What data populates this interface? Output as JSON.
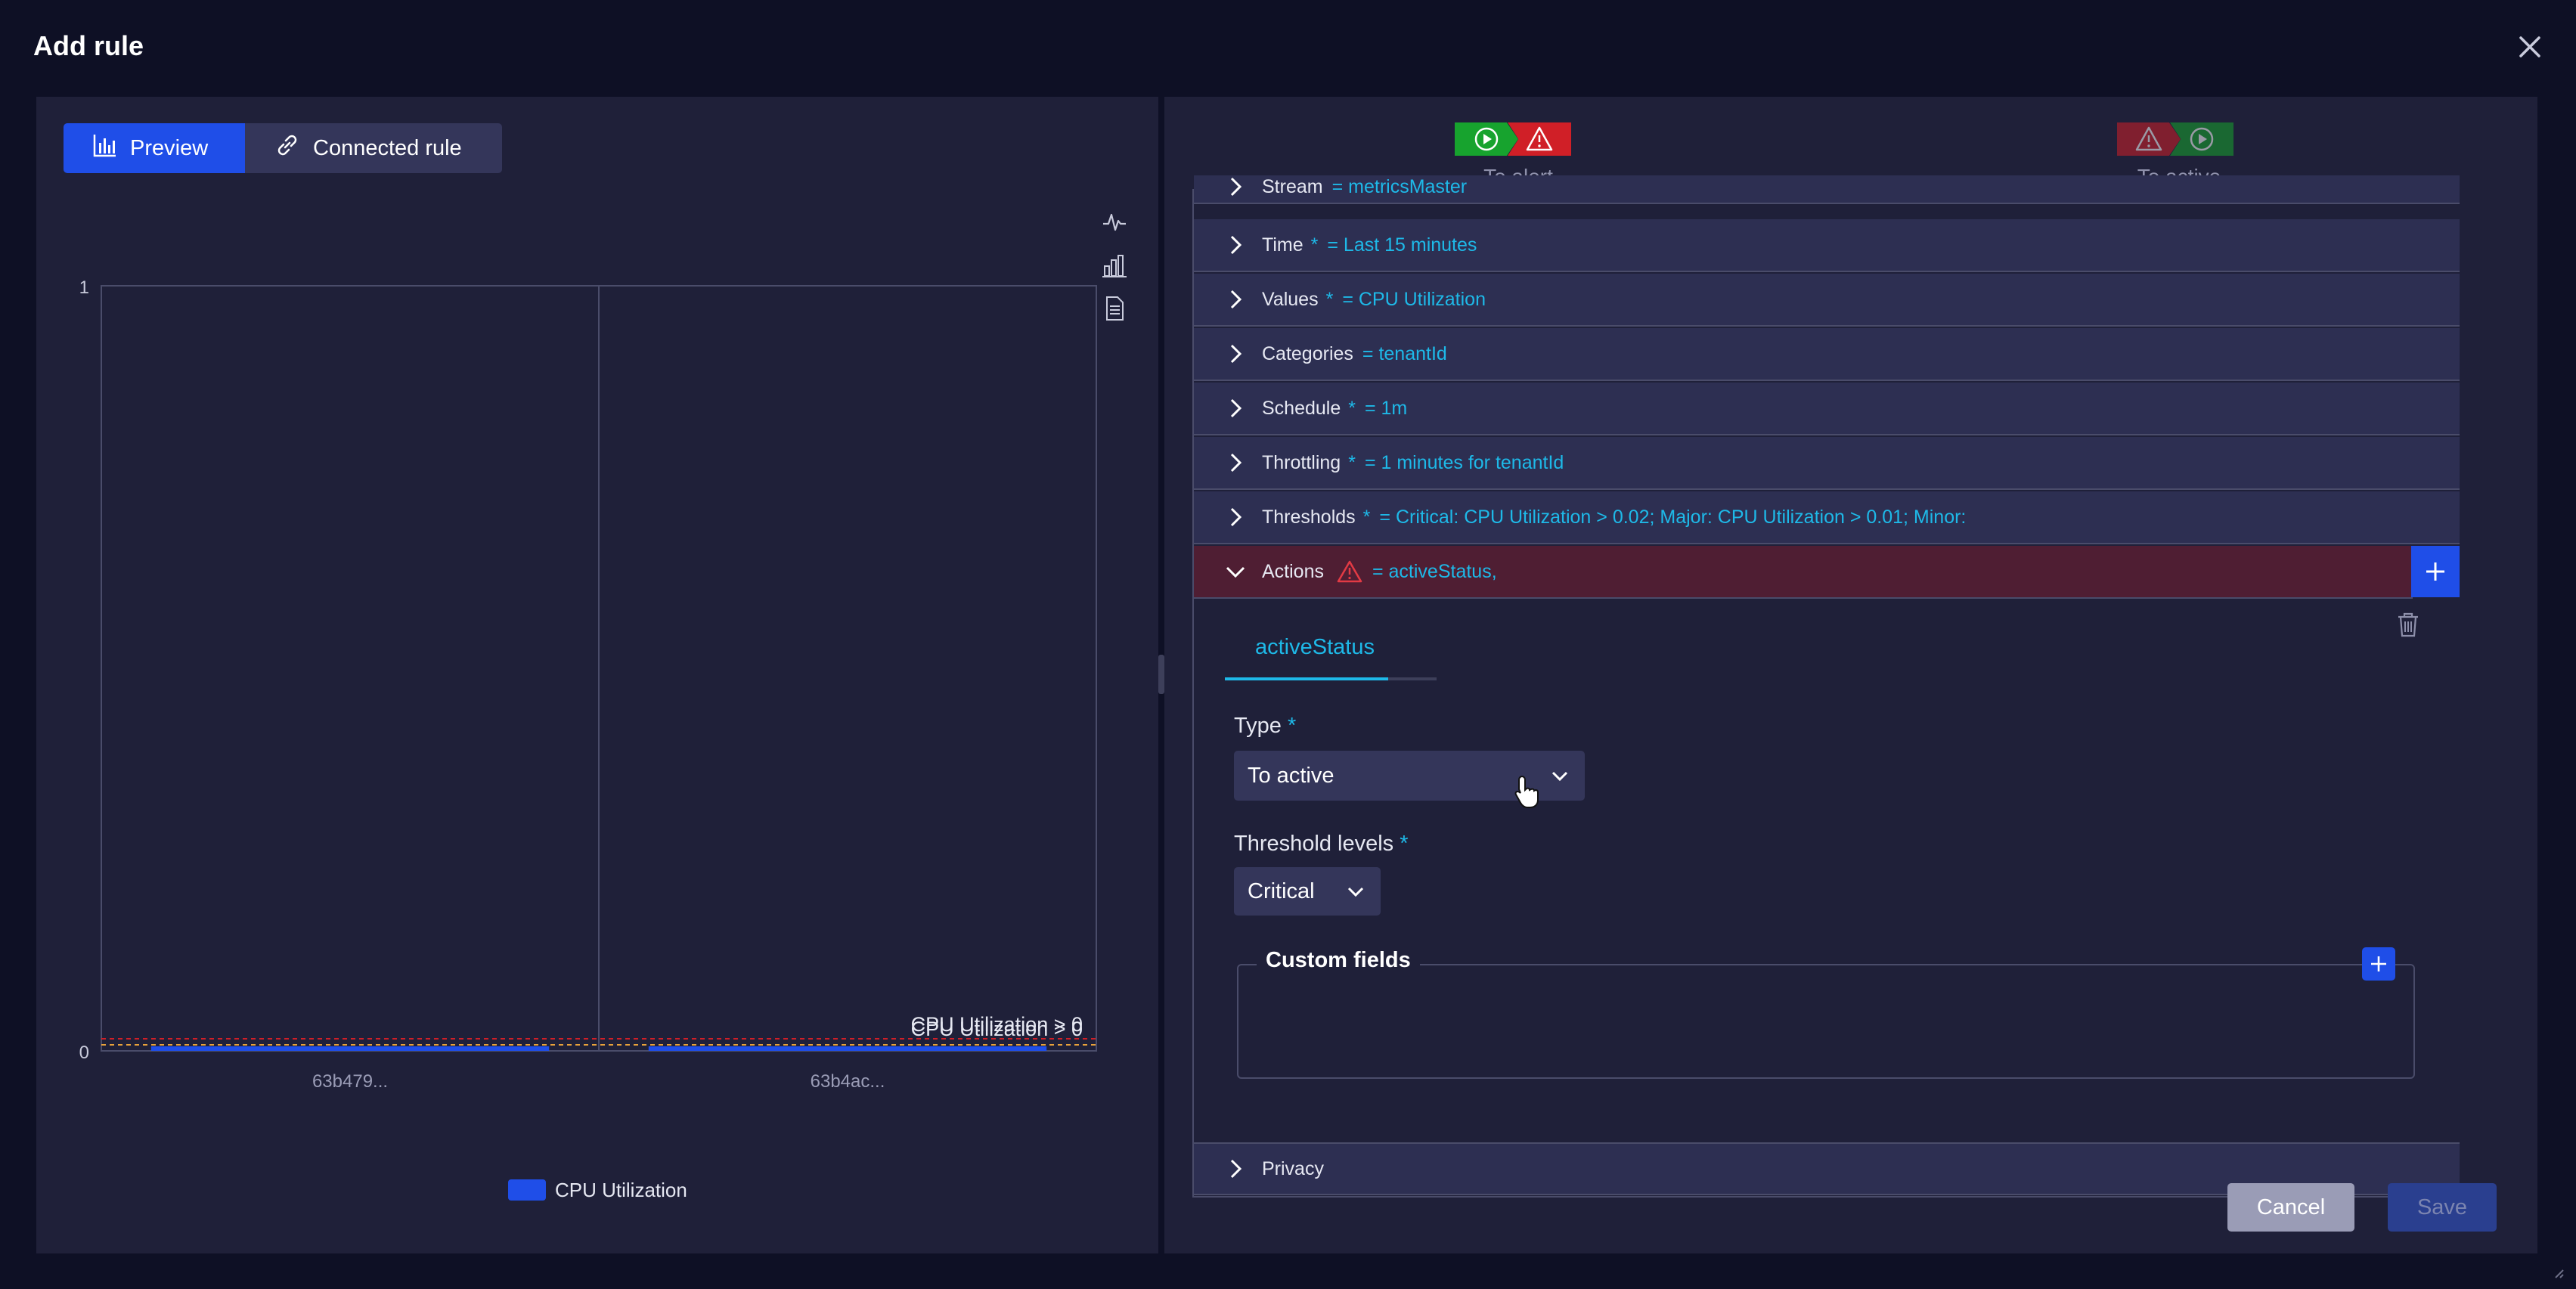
{
  "dialog": {
    "title": "Add rule"
  },
  "tabs": [
    {
      "label": "Preview"
    },
    {
      "label": "Connected rule"
    }
  ],
  "flow": {
    "to_alert_label": "To alert",
    "to_active_label": "To active"
  },
  "colors": {
    "accent": "#1f4ee8",
    "ok_green": "#17a32e",
    "alert_red": "#d01f27",
    "cyan": "#1eb9e8",
    "actions_bg": "#4f1e33"
  },
  "accordion": {
    "stream": {
      "label": "Stream",
      "required": "",
      "value": "= metricsMaster"
    },
    "time": {
      "label": "Time",
      "required": "*",
      "value": "= Last 15 minutes"
    },
    "values": {
      "label": "Values",
      "required": "*",
      "value": "= CPU Utilization"
    },
    "categories": {
      "label": "Categories",
      "required": "",
      "value": "= tenantId"
    },
    "schedule": {
      "label": "Schedule",
      "required": "*",
      "value": "= 1m"
    },
    "throttling": {
      "label": "Throttling",
      "required": "*",
      "value": "= 1 minutes for tenantId"
    },
    "thresholds": {
      "label": "Thresholds",
      "required": "*",
      "value": "= Critical: CPU Utilization > 0.02; Major: CPU Utilization > 0.01; Minor:"
    },
    "actions": {
      "label": "Actions",
      "value": "= activeStatus,"
    },
    "privacy": {
      "label": "Privacy"
    }
  },
  "action_panel": {
    "tab_label": "activeStatus",
    "type_label": "Type",
    "type_required": "*",
    "type_value": "To active",
    "threshold_label": "Threshold levels",
    "threshold_required": "*",
    "threshold_value": "Critical",
    "custom_fields_label": "Custom fields"
  },
  "buttons": {
    "cancel": "Cancel",
    "save": "Save"
  },
  "chart_data": {
    "type": "bar",
    "categories": [
      "63b479...",
      "63b4ac..."
    ],
    "series": [
      {
        "name": "CPU Utilization",
        "values": [
          0,
          0
        ]
      }
    ],
    "ylim": [
      0,
      1
    ],
    "yticks": [
      "0",
      "1"
    ],
    "threshold_labels": [
      "CPU Utilization > 0",
      "CPU Utilization > 0"
    ],
    "grid": true,
    "legend": "bottom"
  }
}
